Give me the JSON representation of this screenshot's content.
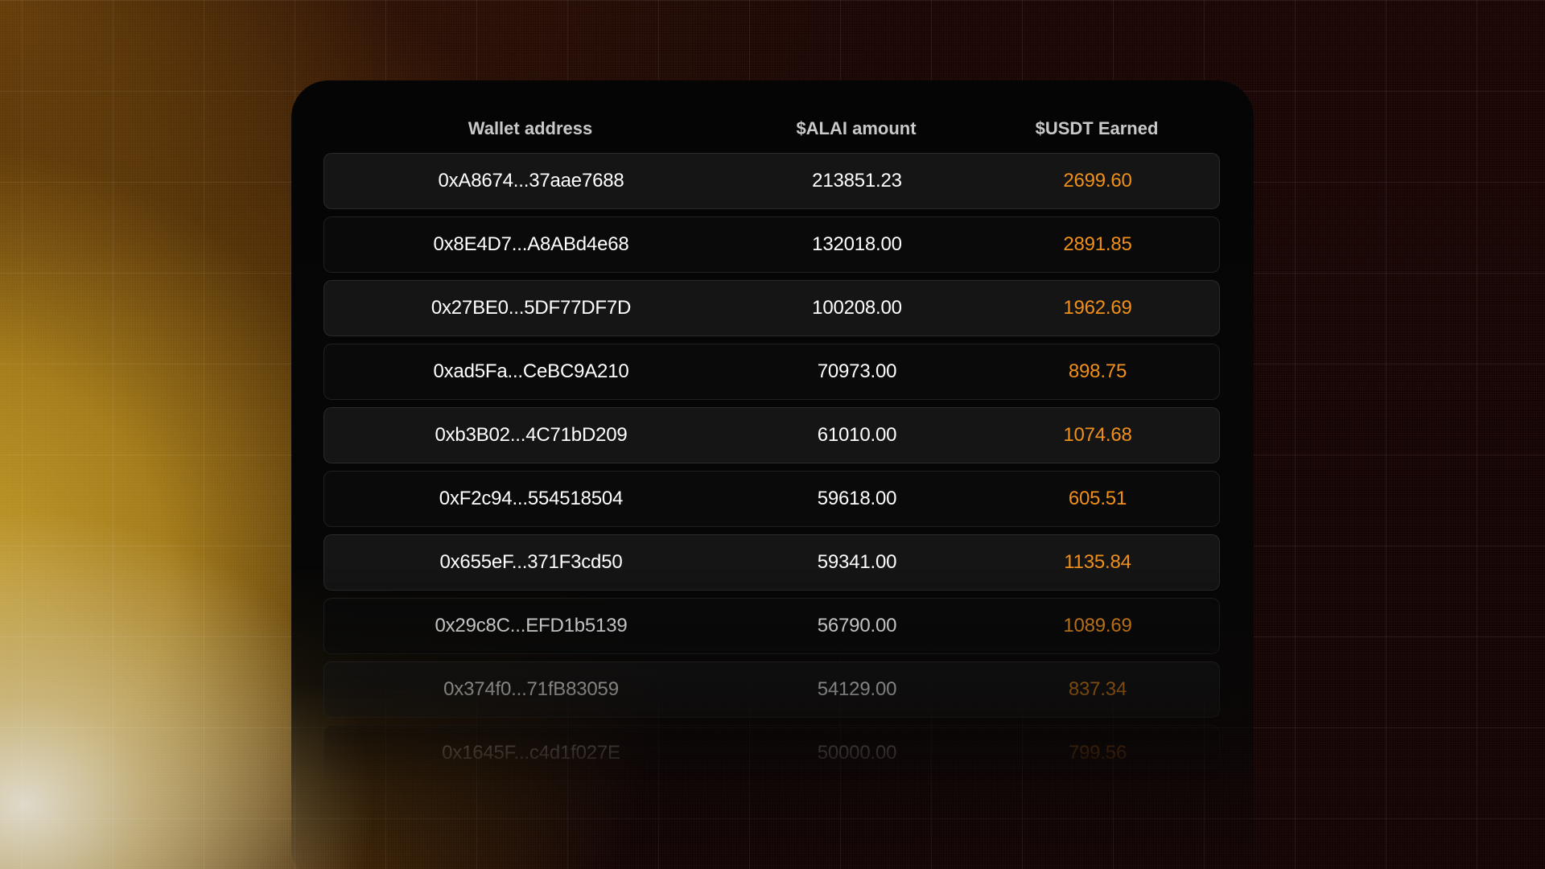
{
  "table": {
    "headers": {
      "wallet": "Wallet address",
      "amount": "$ALAI amount",
      "earned": "$USDT Earned"
    },
    "rows": [
      {
        "wallet": "0xA8674...37aae7688",
        "amount": "213851.23",
        "earned": "2699.60"
      },
      {
        "wallet": "0x8E4D7...A8ABd4e68",
        "amount": "132018.00",
        "earned": "2891.85"
      },
      {
        "wallet": "0x27BE0...5DF77DF7D",
        "amount": "100208.00",
        "earned": "1962.69"
      },
      {
        "wallet": "0xad5Fa...CeBC9A210",
        "amount": "70973.00",
        "earned": "898.75"
      },
      {
        "wallet": "0xb3B02...4C71bD209",
        "amount": "61010.00",
        "earned": "1074.68"
      },
      {
        "wallet": "0xF2c94...554518504",
        "amount": "59618.00",
        "earned": "605.51"
      },
      {
        "wallet": "0x655eF...371F3cd50",
        "amount": "59341.00",
        "earned": "1135.84"
      },
      {
        "wallet": "0x29c8C...EFD1b5139",
        "amount": "56790.00",
        "earned": "1089.69"
      },
      {
        "wallet": "0x374f0...71fB83059",
        "amount": "54129.00",
        "earned": "837.34"
      },
      {
        "wallet": "0x1645F...c4d1f027E",
        "amount": "50000.00",
        "earned": "799.56"
      }
    ]
  },
  "colors": {
    "accent": "#f0901a",
    "text": "#ffffff",
    "header_text": "#c9c9c9",
    "card_bg": "#050505"
  }
}
